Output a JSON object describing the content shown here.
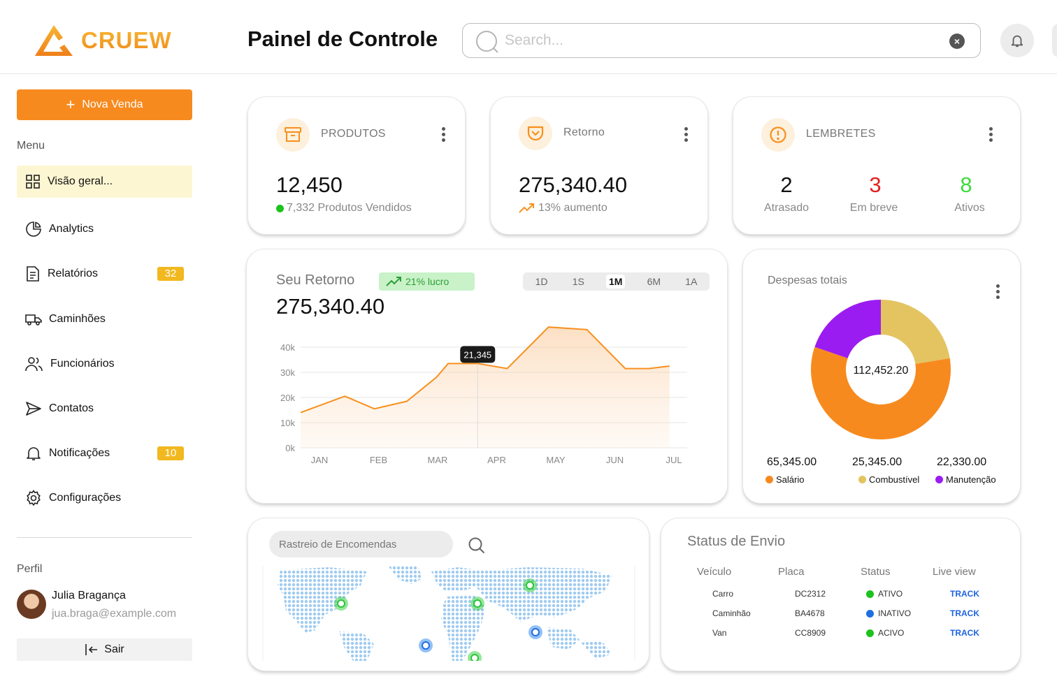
{
  "brand": {
    "name": "CRUEW",
    "color": "#f4a21e"
  },
  "header": {
    "title": "Painel de Controle",
    "search_placeholder": "Search...",
    "clear_icon": "×"
  },
  "sidebar": {
    "new_sale": "Nova Venda",
    "menu_label": "Menu",
    "items": [
      {
        "label": "Visão geral...",
        "icon": "grid-icon",
        "active": true
      },
      {
        "label": "Analytics",
        "icon": "pie-icon"
      },
      {
        "label": "Relatórios",
        "icon": "document-icon",
        "badge": "32"
      },
      {
        "label": "Caminhões",
        "icon": "truck-icon"
      },
      {
        "label": "Funcionários",
        "icon": "users-icon"
      },
      {
        "label": "Contatos",
        "icon": "send-icon"
      },
      {
        "label": "Notificações",
        "icon": "bell-icon",
        "badge": "10"
      },
      {
        "label": "Configurações",
        "icon": "gear-icon"
      }
    ],
    "profile_label": "Perfil",
    "profile": {
      "name": "Julia Bragança",
      "email": "jua.braga@example.com"
    },
    "logout": "Sair"
  },
  "kpis": {
    "produtos": {
      "label": "PRODUTOS",
      "value": "12,450",
      "sub": "7,332 Produtos Vendidos"
    },
    "retorno": {
      "label": "Retorno",
      "value": "275,340.40",
      "sub": "13% aumento"
    },
    "lembretes": {
      "label": "LEMBRETES",
      "items": [
        {
          "value": "2",
          "label": "Atrasado",
          "color": "#111111"
        },
        {
          "value": "3",
          "label": "Em breve",
          "color": "#e22020"
        },
        {
          "value": "8",
          "label": "Ativos",
          "color": "#3ddc3d"
        }
      ]
    }
  },
  "retorno_chart": {
    "title": "Seu Retorno",
    "badge": "21% lucro",
    "value": "275,340.40",
    "ranges": [
      "1D",
      "1S",
      "1M",
      "6M",
      "1A"
    ],
    "selected_range": "1M",
    "tooltip": "21,345"
  },
  "chart_data": [
    {
      "type": "area",
      "title": "Seu Retorno",
      "x_ticks": [
        "JAN",
        "FEB",
        "MAR",
        "APR",
        "MAY",
        "JUN",
        "JUL"
      ],
      "y_ticks": [
        "0k",
        "10k",
        "20k",
        "30k",
        "40k"
      ],
      "ylim": [
        0,
        40000
      ],
      "x": [
        0,
        0.75,
        1.25,
        1.8,
        2.3,
        2.5,
        3.0,
        3.5,
        4.2,
        4.85,
        5.5,
        5.9,
        6.25
      ],
      "y": [
        14000,
        20500,
        15500,
        18500,
        28000,
        33500,
        33500,
        31500,
        48000,
        47000,
        31500,
        31500,
        32500
      ],
      "highlight": {
        "x": 3.0,
        "label": "21,345"
      },
      "color": "#f7901e",
      "grid": true
    },
    {
      "type": "pie",
      "title": "Despesas totais",
      "center_label": "112,452.20",
      "slices": [
        {
          "name": "Salário",
          "value": 65345.0,
          "label": "65,345.00",
          "color": "#f78a1e"
        },
        {
          "name": "Combustível",
          "value": 25345.0,
          "label": "25,345.00",
          "color": "#e3c461"
        },
        {
          "name": "Manutenção",
          "value": 22330.0,
          "label": "22,330.00",
          "color": "#9b1cf0"
        }
      ]
    }
  ],
  "rastreio": {
    "placeholder": "Rastreio de Encomendas"
  },
  "status_envio": {
    "title": "Status de Envio",
    "columns": [
      "Veículo",
      "Placa",
      "Status",
      "Live view"
    ],
    "rows": [
      {
        "veiculo": "Carro",
        "placa": "DC2312",
        "status": "ATIVO",
        "status_color": "#1ec21e",
        "action": "TRACK"
      },
      {
        "veiculo": "Caminhão",
        "placa": "BA4678",
        "status": "INATIVO",
        "status_color": "#1f6fe0",
        "action": "TRACK"
      },
      {
        "veiculo": "Van",
        "placa": "CC8909",
        "status": "ACIVO",
        "status_color": "#1ec21e",
        "action": "TRACK"
      }
    ]
  }
}
